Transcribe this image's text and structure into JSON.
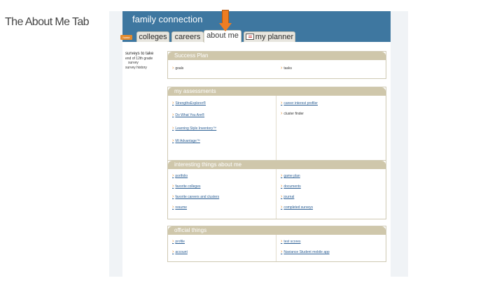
{
  "slide": {
    "title": "The About Me Tab"
  },
  "header": {
    "brand": "family connection",
    "home_label": "home"
  },
  "tabs": [
    {
      "label": "colleges"
    },
    {
      "label": "careers"
    },
    {
      "label": "about me",
      "active": true
    },
    {
      "label": "my planner"
    }
  ],
  "left_nav": {
    "title": "surveys to take",
    "items": [
      "end of 12th grade",
      "survey"
    ],
    "history_label": "survey history"
  },
  "panels": {
    "success_plan": {
      "title": "Success Plan",
      "left": [
        "goals"
      ],
      "right": [
        "tasks"
      ]
    },
    "assessments": {
      "title": "my assessments",
      "left": [
        "StrengthsExplorer®",
        "Do What You Are®",
        "Learning Style Inventory™",
        "MI Advantage™"
      ],
      "right": [
        "career interest profiler",
        "cluster finder"
      ]
    },
    "interesting": {
      "title": "interesting things about me",
      "left": [
        "portfolio",
        "favorite colleges",
        "favorite careers and clusters",
        "resume"
      ],
      "right": [
        "game plan",
        "documents",
        "journal",
        "completed surveys"
      ]
    },
    "official": {
      "title": "official things",
      "left": [
        "profile",
        "account"
      ],
      "right": [
        "test scores",
        "Naviance Student mobile app"
      ]
    }
  },
  "colors": {
    "header": "#3e77a0",
    "panel_header": "#cfc7ab",
    "accent_arrow": "#ee7d22",
    "bullet": "#e08a2c"
  }
}
